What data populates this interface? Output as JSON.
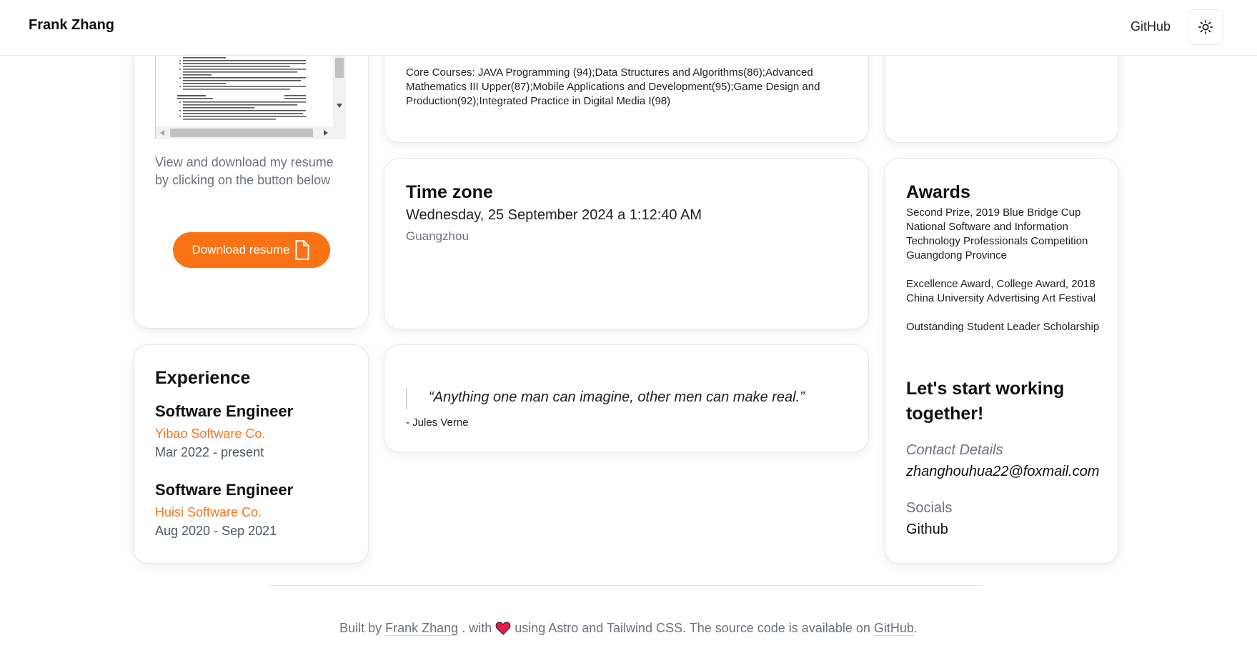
{
  "header": {
    "brand": "Frank Zhang",
    "github_link": "GitHub",
    "theme_toggle_icon": "sun-icon"
  },
  "resume": {
    "description": "View and download my resume by clicking on the button below",
    "download_label": "Download resume",
    "download_icon": "file-icon"
  },
  "education": {
    "courses": "Core Courses: JAVA Programming (94);Data Structures and Algorithms(86);Advanced Mathematics III Upper(87);Mobile Applications and Development(95);Game Design and Production(92);Integrated Practice in Digital Media I(98)"
  },
  "timezone": {
    "title": "Time zone",
    "datetime": "Wednesday, 25 September 2024 a 1:12:40 AM",
    "city": "Guangzhou"
  },
  "awards": {
    "title": "Awards",
    "items": [
      "Second Prize, 2019 Blue Bridge Cup National Software and Information Technology Professionals Competition Guangdong Province",
      "Excellence Award, College Award, 2018 China University Advertising Art Festival",
      "Outstanding Student Leader Scholarship"
    ],
    "cta_heading": "Let's start working together!",
    "contact_label": "Contact Details",
    "contact_email": "zhanghouhua22@foxmail.com",
    "socials_label": "Socials",
    "socials_github": "Github"
  },
  "experience": {
    "title": "Experience",
    "jobs": [
      {
        "role": "Software Engineer",
        "company": "Yibao Software Co.",
        "dates": "Mar 2022 - present"
      },
      {
        "role": "Software Engineer",
        "company": "Huisi Software Co.",
        "dates": "Aug 2020 - Sep 2021"
      }
    ]
  },
  "quote": {
    "text": "“Anything one man can imagine, other men can make real.”",
    "author": "- Jules Verne"
  },
  "footer": {
    "built_by": "Built by",
    "author_link": "Frank Zhang",
    "with": ". with",
    "heart_icon": "heart-icon",
    "middle": "using Astro and Tailwind CSS. The source code is available on",
    "source_link": "GitHub",
    "end": "."
  },
  "colors": {
    "accent": "#f97316",
    "muted": "#6b7280",
    "heart": "#e11d48"
  }
}
